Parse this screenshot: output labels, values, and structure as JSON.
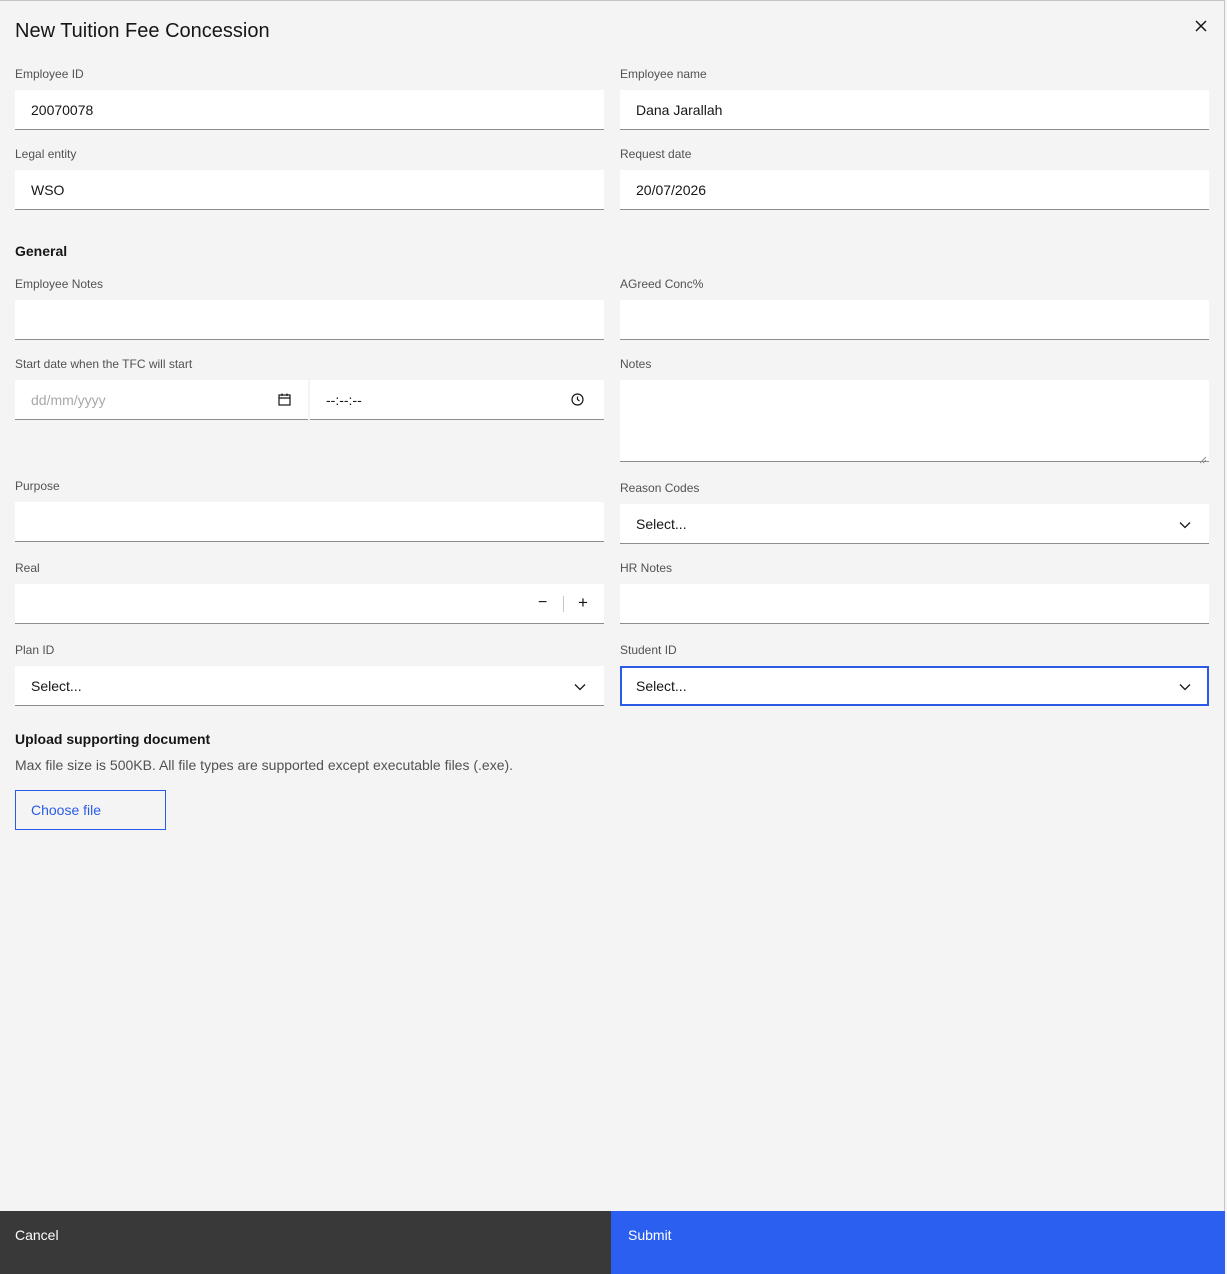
{
  "modal": {
    "title": "New Tuition Fee Concession"
  },
  "fields": {
    "employee_id": {
      "label": "Employee ID",
      "value": "20070078"
    },
    "employee_name": {
      "label": "Employee name",
      "value": "Dana Jarallah"
    },
    "legal_entity": {
      "label": "Legal entity",
      "value": "WSO"
    },
    "request_date": {
      "label": "Request date",
      "value": "20/07/2026"
    },
    "general_heading": "General",
    "employee_notes": {
      "label": "Employee Notes",
      "value": ""
    },
    "agreed_conc": {
      "label": "AGreed Conc%",
      "value": ""
    },
    "start_date": {
      "label": "Start date when the TFC will start",
      "date_placeholder": "dd/mm/yyyy",
      "time_placeholder": "--:--:--"
    },
    "notes": {
      "label": "Notes",
      "value": ""
    },
    "purpose": {
      "label": "Purpose",
      "value": ""
    },
    "reason_codes": {
      "label": "Reason Codes",
      "value": "Select..."
    },
    "real": {
      "label": "Real",
      "value": "",
      "minus": "−",
      "plus": "+"
    },
    "hr_notes": {
      "label": "HR Notes",
      "value": ""
    },
    "plan_id": {
      "label": "Plan ID",
      "value": "Select..."
    },
    "student_id": {
      "label": "Student ID",
      "value": "Select..."
    }
  },
  "upload": {
    "heading": "Upload supporting document",
    "helper": "Max file size is 500KB. All file types are supported except executable files (.exe).",
    "button": "Choose file"
  },
  "footer": {
    "cancel": "Cancel",
    "submit": "Submit"
  },
  "colors": {
    "primary": "#2b5fef",
    "secondary": "#393939",
    "background": "#f4f4f4"
  }
}
